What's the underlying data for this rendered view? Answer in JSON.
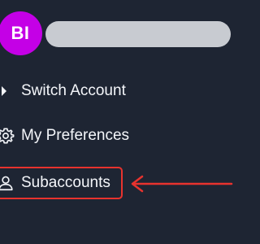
{
  "account": {
    "avatar_initials": "BI",
    "avatar_color": "#c400e6"
  },
  "menu": {
    "items": [
      {
        "label": "Switch Account",
        "icon": "chevron-right-icon"
      },
      {
        "label": "My Preferences",
        "icon": "gear-icon"
      },
      {
        "label": "Subaccounts",
        "icon": "user-icon",
        "highlighted": true
      }
    ]
  },
  "annotation": {
    "highlight_color": "#e8332e",
    "arrow_target": "Subaccounts"
  },
  "theme": {
    "background": "#1e2533",
    "text_color": "#f4f6fa",
    "placeholder_bar": "#c8cbd1"
  }
}
